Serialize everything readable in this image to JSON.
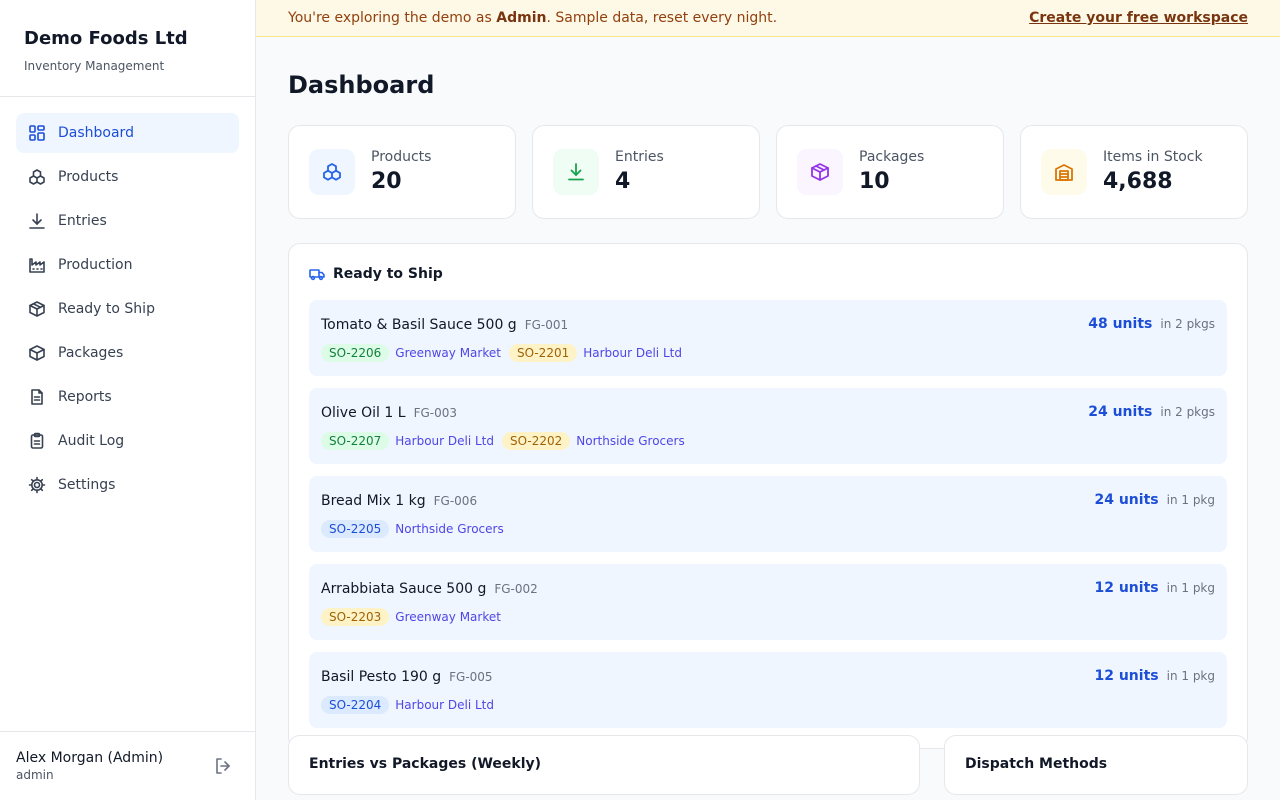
{
  "app": {
    "brand": "Demo Foods Ltd",
    "subtitle": "Inventory Management"
  },
  "banner": {
    "text_before": "You're exploring the demo as ",
    "role": "Admin",
    "text_after": ". Sample data, reset every night.",
    "cta": "Create your free workspace"
  },
  "sidebar": {
    "items": [
      {
        "label": "Dashboard",
        "icon": "dashboard-icon"
      },
      {
        "label": "Products",
        "icon": "products-icon"
      },
      {
        "label": "Entries",
        "icon": "download-icon"
      },
      {
        "label": "Production",
        "icon": "factory-icon"
      },
      {
        "label": "Ready to Ship",
        "icon": "box-icon"
      },
      {
        "label": "Packages",
        "icon": "package-icon"
      },
      {
        "label": "Reports",
        "icon": "report-icon"
      },
      {
        "label": "Audit Log",
        "icon": "clipboard-icon"
      },
      {
        "label": "Settings",
        "icon": "gear-icon"
      }
    ],
    "active": "Dashboard"
  },
  "user": {
    "name": "Alex Morgan (Admin)",
    "role": "admin"
  },
  "page": {
    "title": "Dashboard"
  },
  "stats": [
    {
      "label": "Products",
      "value": "20",
      "color": "#2563eb",
      "bg": "#eff6ff"
    },
    {
      "label": "Entries",
      "value": "4",
      "color": "#16a34a",
      "bg": "#f0fdf4"
    },
    {
      "label": "Packages",
      "value": "10",
      "color": "#9333ea",
      "bg": "#faf5ff"
    },
    {
      "label": "Items in Stock",
      "value": "4,688",
      "color": "#d97706",
      "bg": "#fffbeb"
    }
  ],
  "ready_to_ship": {
    "title": "Ready to Ship",
    "rows": [
      {
        "name": "Tomato & Basil Sauce 500 g",
        "code": "FG-001",
        "units": "48 units",
        "pkgs": "in 2 pkgs",
        "orders": [
          {
            "id": "SO-2206",
            "customer": "Greenway Market",
            "color": "green"
          },
          {
            "id": "SO-2201",
            "customer": "Harbour Deli Ltd",
            "color": "yellow"
          }
        ]
      },
      {
        "name": "Olive Oil 1 L",
        "code": "FG-003",
        "units": "24 units",
        "pkgs": "in 2 pkgs",
        "orders": [
          {
            "id": "SO-2207",
            "customer": "Harbour Deli Ltd",
            "color": "green"
          },
          {
            "id": "SO-2202",
            "customer": "Northside Grocers",
            "color": "yellow"
          }
        ]
      },
      {
        "name": "Bread Mix 1 kg",
        "code": "FG-006",
        "units": "24 units",
        "pkgs": "in 1 pkg",
        "orders": [
          {
            "id": "SO-2205",
            "customer": "Northside Grocers",
            "color": "blue"
          }
        ]
      },
      {
        "name": "Arrabbiata Sauce 500 g",
        "code": "FG-002",
        "units": "12 units",
        "pkgs": "in 1 pkg",
        "orders": [
          {
            "id": "SO-2203",
            "customer": "Greenway Market",
            "color": "yellow"
          }
        ]
      },
      {
        "name": "Basil Pesto 190 g",
        "code": "FG-005",
        "units": "12 units",
        "pkgs": "in 1 pkg",
        "orders": [
          {
            "id": "SO-2204",
            "customer": "Harbour Deli Ltd",
            "color": "blue"
          }
        ]
      }
    ]
  },
  "bottom_cards": [
    {
      "title": "Entries vs Packages (Weekly)"
    },
    {
      "title": "Dispatch Methods"
    }
  ]
}
